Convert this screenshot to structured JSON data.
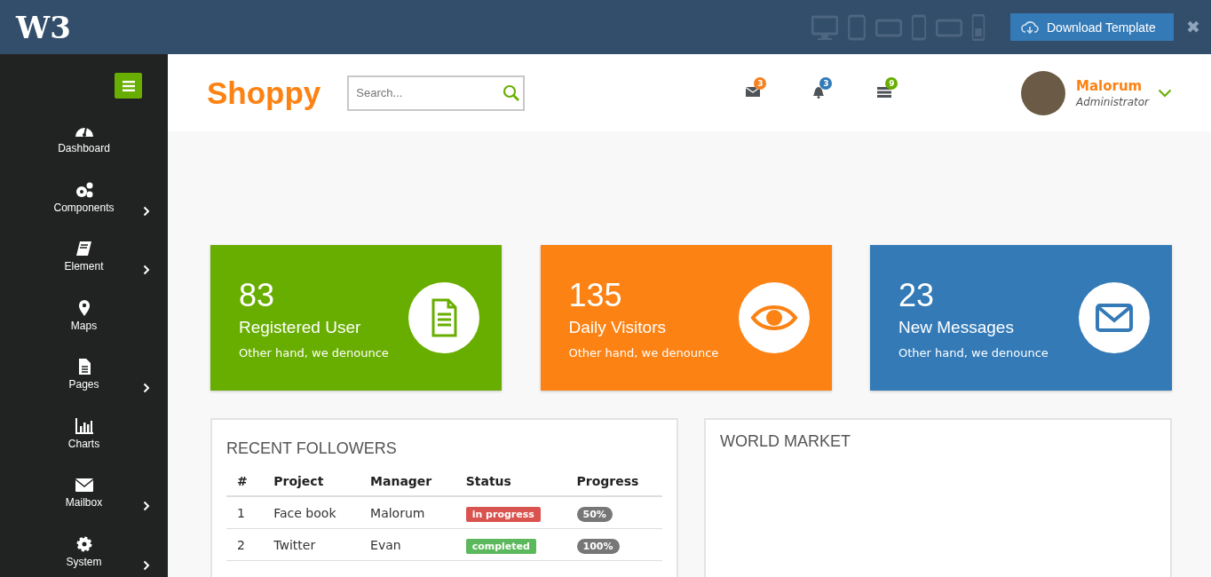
{
  "topbar": {
    "logo": "W3",
    "devices": [
      {
        "kind": "desktop"
      },
      {
        "kind": "tablet"
      },
      {
        "kind": "tablet-landscape"
      },
      {
        "kind": "phone"
      },
      {
        "kind": "phone-landscape"
      },
      {
        "kind": "keypad-phone"
      }
    ],
    "download_button": "Download Template",
    "close": "✖"
  },
  "sidebar": {
    "items": [
      {
        "label": "Dashboard",
        "kind": "gauge",
        "has_submenu": false
      },
      {
        "label": "Components",
        "kind": "gears",
        "has_submenu": true
      },
      {
        "label": "Element",
        "kind": "book",
        "has_submenu": true
      },
      {
        "label": "Maps",
        "kind": "pin",
        "has_submenu": false
      },
      {
        "label": "Pages",
        "kind": "file",
        "has_submenu": true
      },
      {
        "label": "Charts",
        "kind": "chart",
        "has_submenu": false
      },
      {
        "label": "Mailbox",
        "kind": "mail",
        "has_submenu": true
      },
      {
        "label": "System",
        "kind": "gear",
        "has_submenu": true
      }
    ]
  },
  "header": {
    "brand": "Shoppy",
    "search": {
      "placeholder": "Search..."
    },
    "notifications": [
      {
        "kind": "mail",
        "count": "3",
        "color": "#f5811f"
      },
      {
        "kind": "bell",
        "count": "3",
        "color": "#337ab7"
      },
      {
        "kind": "list",
        "count": "9",
        "color": "#68ae00"
      }
    ],
    "user": {
      "name": "Malorum",
      "role": "Administrator"
    }
  },
  "stat_cards": [
    {
      "value": "83",
      "title": "Registered User",
      "subtitle": "Other hand, we denounce",
      "kind": "file",
      "color": "#68ae00"
    },
    {
      "value": "135",
      "title": "Daily Visitors",
      "subtitle": "Other hand, we denounce",
      "kind": "eye",
      "color": "#fc8213"
    },
    {
      "value": "23",
      "title": "New Messages",
      "subtitle": "Other hand, we denounce",
      "kind": "mail",
      "color": "#337ab7"
    }
  ],
  "recent_followers": {
    "title": "RECENT FOLLOWERS",
    "columns": [
      "#",
      "Project",
      "Manager",
      "Status",
      "Progress"
    ],
    "rows": [
      {
        "number": "1",
        "project": "Face book",
        "manager": "Malorum",
        "status": "in progress",
        "color": "#d9534f",
        "progress": "50%"
      },
      {
        "number": "2",
        "project": "Twitter",
        "manager": "Evan",
        "status": "completed",
        "color": "#5cb85c",
        "progress": "100%"
      }
    ]
  },
  "world_market": {
    "title": "WORLD MARKET"
  }
}
